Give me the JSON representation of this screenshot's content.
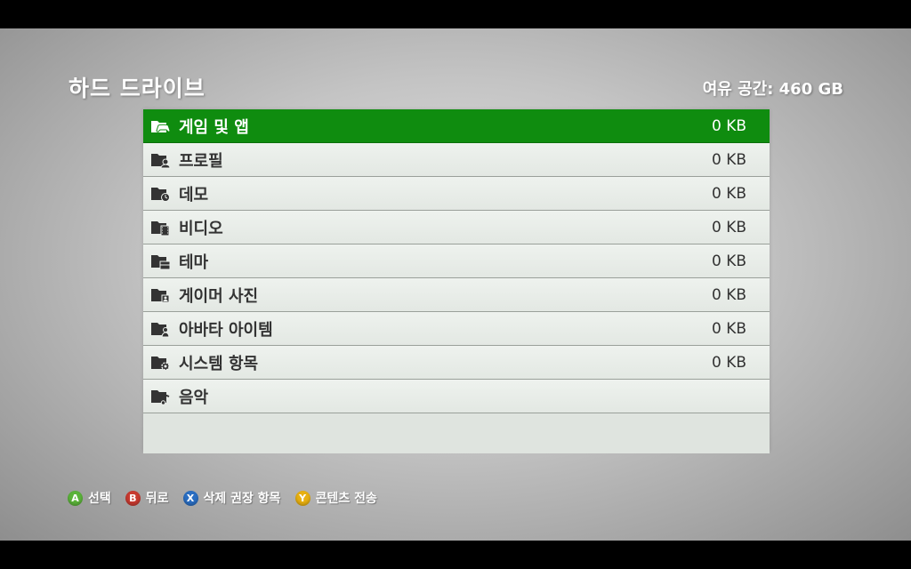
{
  "header": {
    "title": "하드 드라이브",
    "free_space": "여유 공간: 460 GB"
  },
  "items": [
    {
      "label": "게임 및 앱",
      "size": "0 KB",
      "icon": "games-apps-icon",
      "selected": true
    },
    {
      "label": "프로필",
      "size": "0 KB",
      "icon": "profile-icon",
      "selected": false
    },
    {
      "label": "데모",
      "size": "0 KB",
      "icon": "demo-icon",
      "selected": false
    },
    {
      "label": "비디오",
      "size": "0 KB",
      "icon": "video-icon",
      "selected": false
    },
    {
      "label": "테마",
      "size": "0 KB",
      "icon": "theme-icon",
      "selected": false
    },
    {
      "label": "게이머 사진",
      "size": "0 KB",
      "icon": "gamer-picture-icon",
      "selected": false
    },
    {
      "label": "아바타 아이템",
      "size": "0 KB",
      "icon": "avatar-item-icon",
      "selected": false
    },
    {
      "label": "시스템 항목",
      "size": "0 KB",
      "icon": "system-item-icon",
      "selected": false
    },
    {
      "label": "음악",
      "size": "",
      "icon": "music-icon",
      "selected": false
    }
  ],
  "footer": {
    "hints": [
      {
        "button": "A",
        "label": "선택",
        "color": "#5bb33a"
      },
      {
        "button": "B",
        "label": "뒤로",
        "color": "#c83a30"
      },
      {
        "button": "X",
        "label": "삭제 권장 항목",
        "color": "#2a6ec2"
      },
      {
        "button": "Y",
        "label": "콘텐츠 전송",
        "color": "#e8b010"
      }
    ]
  },
  "colors": {
    "selected_row": "#0f8c0f",
    "row_bg": "#e8ece8"
  }
}
